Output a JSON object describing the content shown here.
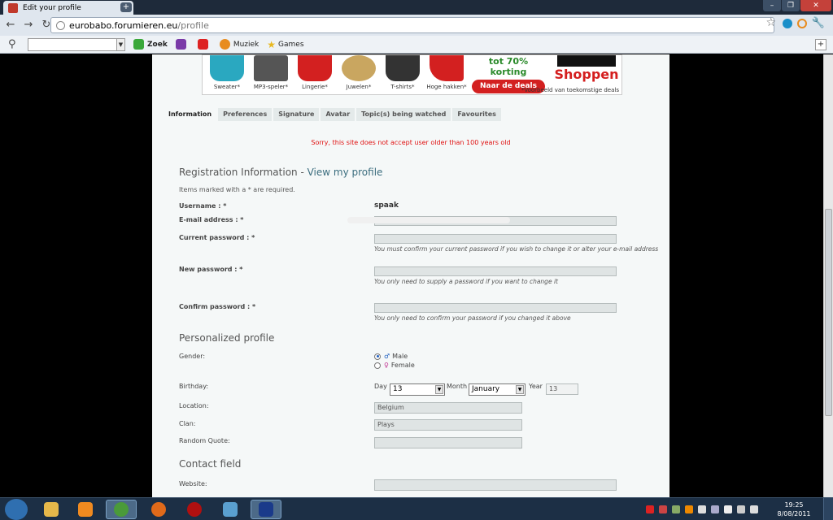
{
  "browser": {
    "tab_title": "Edit your profile",
    "tab_close": "x",
    "new_tab": "+",
    "url_host": "eurobabo.forumieren.eu",
    "url_path": "/profile"
  },
  "bookmarks": {
    "search_label": "Zoek",
    "items": [
      {
        "label": "",
        "icon": "chat-icon",
        "color": "#7a3aa8"
      },
      {
        "label": "",
        "icon": "youtube-icon",
        "color": "#d22"
      },
      {
        "label": "Muziek",
        "icon": "music-icon",
        "color": "#e88c1f"
      },
      {
        "label": "Games",
        "icon": "star-icon",
        "color": "#f0c020"
      }
    ]
  },
  "ad": {
    "products": [
      "Sweater*",
      "MP3-speler*",
      "Lingerie*",
      "Juwelen*",
      "T-shirts*",
      "Hoge hakken*"
    ],
    "product_colors": [
      "#2aa8c0",
      "#555",
      "#d32020",
      "#c9a660",
      "#333",
      "#d32020"
    ],
    "korting": "tot 70% korting",
    "deals_button": "Naar de deals",
    "shoppen": "Shoppen",
    "note": "*Voorbeeld van toekomstige deals"
  },
  "tabs": [
    "Information",
    "Preferences",
    "Signature",
    "Avatar",
    "Topic(s) being watched",
    "Favourites"
  ],
  "error": "Sorry, this site does not accept user older than 100 years old",
  "registration": {
    "title": "Registration Information",
    "separator": " - ",
    "view_link": "View my profile",
    "required_note": "Items marked with a * are required.",
    "username_label": "Username : *",
    "username_value": "spaak",
    "email_label": "E-mail address : *",
    "current_pw_label": "Current password : *",
    "current_pw_hint": "You must confirm your current password if you wish to change it or alter your e-mail address",
    "new_pw_label": "New password : *",
    "new_pw_hint": "You only need to supply a password if you want to change it",
    "confirm_pw_label": "Confirm password : *",
    "confirm_pw_hint": "You only need to confirm your password if you changed it above"
  },
  "personal": {
    "title": "Personalized profile",
    "gender_label": "Gender:",
    "male": "Male",
    "female": "Female",
    "birthday_label": "Birthday:",
    "day_label": "Day",
    "day_value": "13",
    "month_label": "Month",
    "month_value": "January",
    "year_label": "Year",
    "year_value": "13",
    "location_label": "Location:",
    "location_value": "Belgium",
    "clan_label": "Clan:",
    "clan_value": "Plays",
    "quote_label": "Random Quote:"
  },
  "contact": {
    "title": "Contact field",
    "website_label": "Website:"
  },
  "taskbar": {
    "time": "19:25",
    "date": "8/08/2011",
    "apps": [
      {
        "name": "explorer-icon",
        "color": "#e6b84a"
      },
      {
        "name": "media-player-icon",
        "color": "#f08a20"
      },
      {
        "name": "chrome-icon",
        "color": "#4a9a3a"
      },
      {
        "name": "firefox-icon",
        "color": "#e06a1a"
      },
      {
        "name": "apple-icon",
        "color": "#b01010"
      },
      {
        "name": "messenger-icon",
        "color": "#5aa0d0"
      },
      {
        "name": "league-icon",
        "color": "#1a3a8a"
      }
    ]
  }
}
